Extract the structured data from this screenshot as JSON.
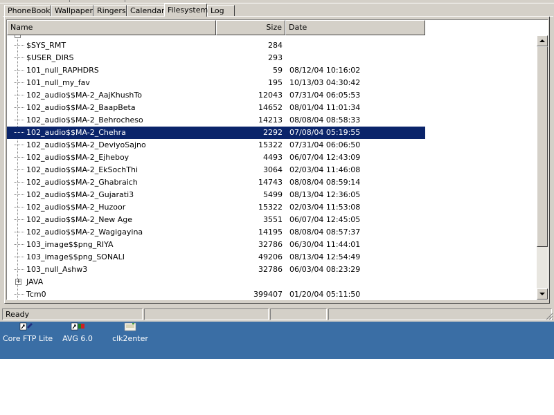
{
  "tabs": [
    {
      "label": "PhoneBook",
      "active": false
    },
    {
      "label": "Wallpaper",
      "active": false
    },
    {
      "label": "Ringers",
      "active": false
    },
    {
      "label": "Calendar",
      "active": false
    },
    {
      "label": "Filesystem",
      "active": true
    },
    {
      "label": "Log",
      "active": false
    }
  ],
  "columns": {
    "name": "Name",
    "size": "Size",
    "date": "Date"
  },
  "files": [
    {
      "name": "$SYS_RMT",
      "size": "284",
      "date": ""
    },
    {
      "name": "$USER_DIRS",
      "size": "293",
      "date": ""
    },
    {
      "name": "101_null_RAPHDRS",
      "size": "59",
      "date": "08/12/04 10:16:02"
    },
    {
      "name": "101_null_my_fav",
      "size": "195",
      "date": "10/13/03 04:30:42"
    },
    {
      "name": "102_audio$$MA-2_AajKhushTo",
      "size": "12043",
      "date": "07/31/04 06:05:53"
    },
    {
      "name": "102_audio$$MA-2_BaapBeta",
      "size": "14652",
      "date": "08/01/04 11:01:34"
    },
    {
      "name": "102_audio$$MA-2_Behrocheso",
      "size": "14213",
      "date": "08/08/04 08:58:33"
    },
    {
      "name": "102_audio$$MA-2_Chehra",
      "size": "2292",
      "date": "07/08/04 05:19:55",
      "selected": true
    },
    {
      "name": "102_audio$$MA-2_DeviyoSajno",
      "size": "15322",
      "date": "07/31/04 06:06:50"
    },
    {
      "name": "102_audio$$MA-2_Ejheboy",
      "size": "4493",
      "date": "06/07/04 12:43:09"
    },
    {
      "name": "102_audio$$MA-2_EkSochThi",
      "size": "3064",
      "date": "02/03/04 11:46:08"
    },
    {
      "name": "102_audio$$MA-2_Ghabraich",
      "size": "14743",
      "date": "08/08/04 08:59:14"
    },
    {
      "name": "102_audio$$MA-2_Gujarati3",
      "size": "5499",
      "date": "08/13/04 12:36:05"
    },
    {
      "name": "102_audio$$MA-2_Huzoor",
      "size": "15322",
      "date": "02/03/04 11:53:08"
    },
    {
      "name": "102_audio$$MA-2_New Age",
      "size": "3551",
      "date": "06/07/04 12:45:05"
    },
    {
      "name": "102_audio$$MA-2_Wagigayina",
      "size": "14195",
      "date": "08/08/04 08:57:37"
    },
    {
      "name": "103_image$$png_RIYA",
      "size": "32786",
      "date": "06/30/04 11:44:01"
    },
    {
      "name": "103_image$$png_SONALI",
      "size": "49206",
      "date": "08/13/04 12:54:49"
    },
    {
      "name": "103_null_Ashw3",
      "size": "32786",
      "date": "06/03/04 08:23:29"
    },
    {
      "name": "JAVA",
      "size": "",
      "date": "",
      "folder": true,
      "expander": "+"
    },
    {
      "name": "Tcm0",
      "size": "399407",
      "date": "01/20/04 05:11:50"
    }
  ],
  "status": {
    "text": "Ready"
  },
  "desktop_icons": [
    {
      "label": "Core FTP Lite",
      "icon": "core-ftp-icon"
    },
    {
      "label": "AVG 6.0",
      "icon": "avg-icon"
    },
    {
      "label": "clk2enter",
      "icon": "clk2enter-icon"
    }
  ],
  "colors": {
    "selection": "#0a246a",
    "desktop": "#3a6ea5",
    "face": "#d4d0c8"
  }
}
